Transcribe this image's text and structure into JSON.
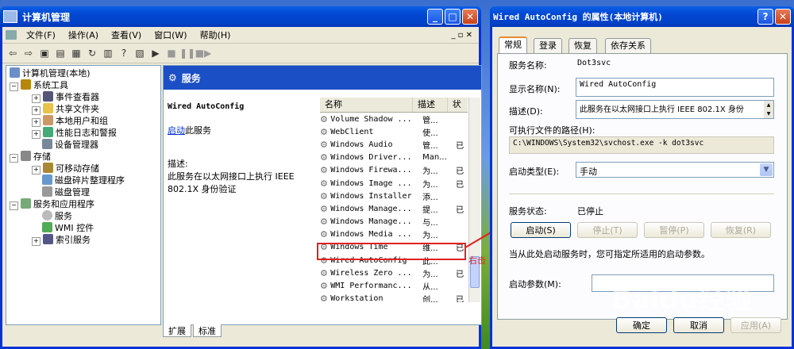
{
  "mmc": {
    "title": "计算机管理",
    "menu": [
      "文件(F)",
      "操作(A)",
      "查看(V)",
      "窗口(W)",
      "帮助(H)"
    ],
    "tree": [
      {
        "label": "计算机管理(本地)"
      },
      {
        "label": "系统工具"
      },
      {
        "label": "事件查看器"
      },
      {
        "label": "共享文件夹"
      },
      {
        "label": "本地用户和组"
      },
      {
        "label": "性能日志和警报"
      },
      {
        "label": "设备管理器"
      },
      {
        "label": "存储"
      },
      {
        "label": "可移动存储"
      },
      {
        "label": "磁盘碎片整理程序"
      },
      {
        "label": "磁盘管理"
      },
      {
        "label": "服务和应用程序"
      },
      {
        "label": "服务"
      },
      {
        "label": "WMI 控件"
      },
      {
        "label": "索引服务"
      }
    ],
    "pane_title": "服务",
    "selected_name": "Wired AutoConfig",
    "start_link": "启动",
    "start_link_suffix": "此服务",
    "desc_label": "描述:",
    "desc_text": "此服务在以太网接口上执行 IEEE 802.1X 身份验证",
    "columns": [
      "名称",
      "描述",
      "状"
    ],
    "services": [
      {
        "name": "Volume Shadow ...",
        "desc": "管...",
        "status": ""
      },
      {
        "name": "WebClient",
        "desc": "使...",
        "status": ""
      },
      {
        "name": "Windows Audio",
        "desc": "管...",
        "status": "已"
      },
      {
        "name": "Windows Driver...",
        "desc": "Man...",
        "status": ""
      },
      {
        "name": "Windows Firewa...",
        "desc": "为...",
        "status": "已"
      },
      {
        "name": "Windows Image ...",
        "desc": "为...",
        "status": "已"
      },
      {
        "name": "Windows Installer",
        "desc": "添...",
        "status": ""
      },
      {
        "name": "Windows Manage...",
        "desc": "提...",
        "status": "已"
      },
      {
        "name": "Windows Manage...",
        "desc": "与...",
        "status": ""
      },
      {
        "name": "Windows Media ...",
        "desc": "为...",
        "status": ""
      },
      {
        "name": "Windows Time",
        "desc": "维...",
        "status": "已"
      },
      {
        "name": "Wired AutoConfig",
        "desc": "此...",
        "status": ""
      },
      {
        "name": "Wireless Zero ...",
        "desc": "为...",
        "status": "已"
      },
      {
        "name": "WMI Performanc...",
        "desc": "从...",
        "status": ""
      },
      {
        "name": "Workstation",
        "desc": "创...",
        "status": "已"
      }
    ],
    "bottom_tabs": [
      "扩展",
      "标准"
    ],
    "annotation": "右击"
  },
  "props": {
    "title": "Wired AutoConfig 的属性(本地计算机)",
    "tabs": [
      "常规",
      "登录",
      "恢复",
      "依存关系"
    ],
    "service_name_label": "服务名称:",
    "service_name": "Dot3svc",
    "display_name_label": "显示名称(N):",
    "display_name": "Wired AutoConfig",
    "description_label": "描述(D):",
    "description": "此服务在以太网接口上执行 IEEE 802.1X 身份",
    "exe_path_label": "可执行文件的路径(H):",
    "exe_path": "C:\\WINDOWS\\System32\\svchost.exe -k dot3svc",
    "startup_type_label": "启动类型(E):",
    "startup_type": "手动",
    "status_label": "服务状态:",
    "status_value": "已停止",
    "buttons": {
      "start": "启动(S)",
      "stop": "停止(T)",
      "pause": "暂停(P)",
      "resume": "恢复(R)"
    },
    "hint": "当从此处启动服务时，您可指定所适用的启动参数。",
    "params_label": "启动参数(M):",
    "params_value": "",
    "ok": "确定",
    "cancel": "取消",
    "apply": "应用(A)"
  },
  "watermark": "Baidu经验"
}
